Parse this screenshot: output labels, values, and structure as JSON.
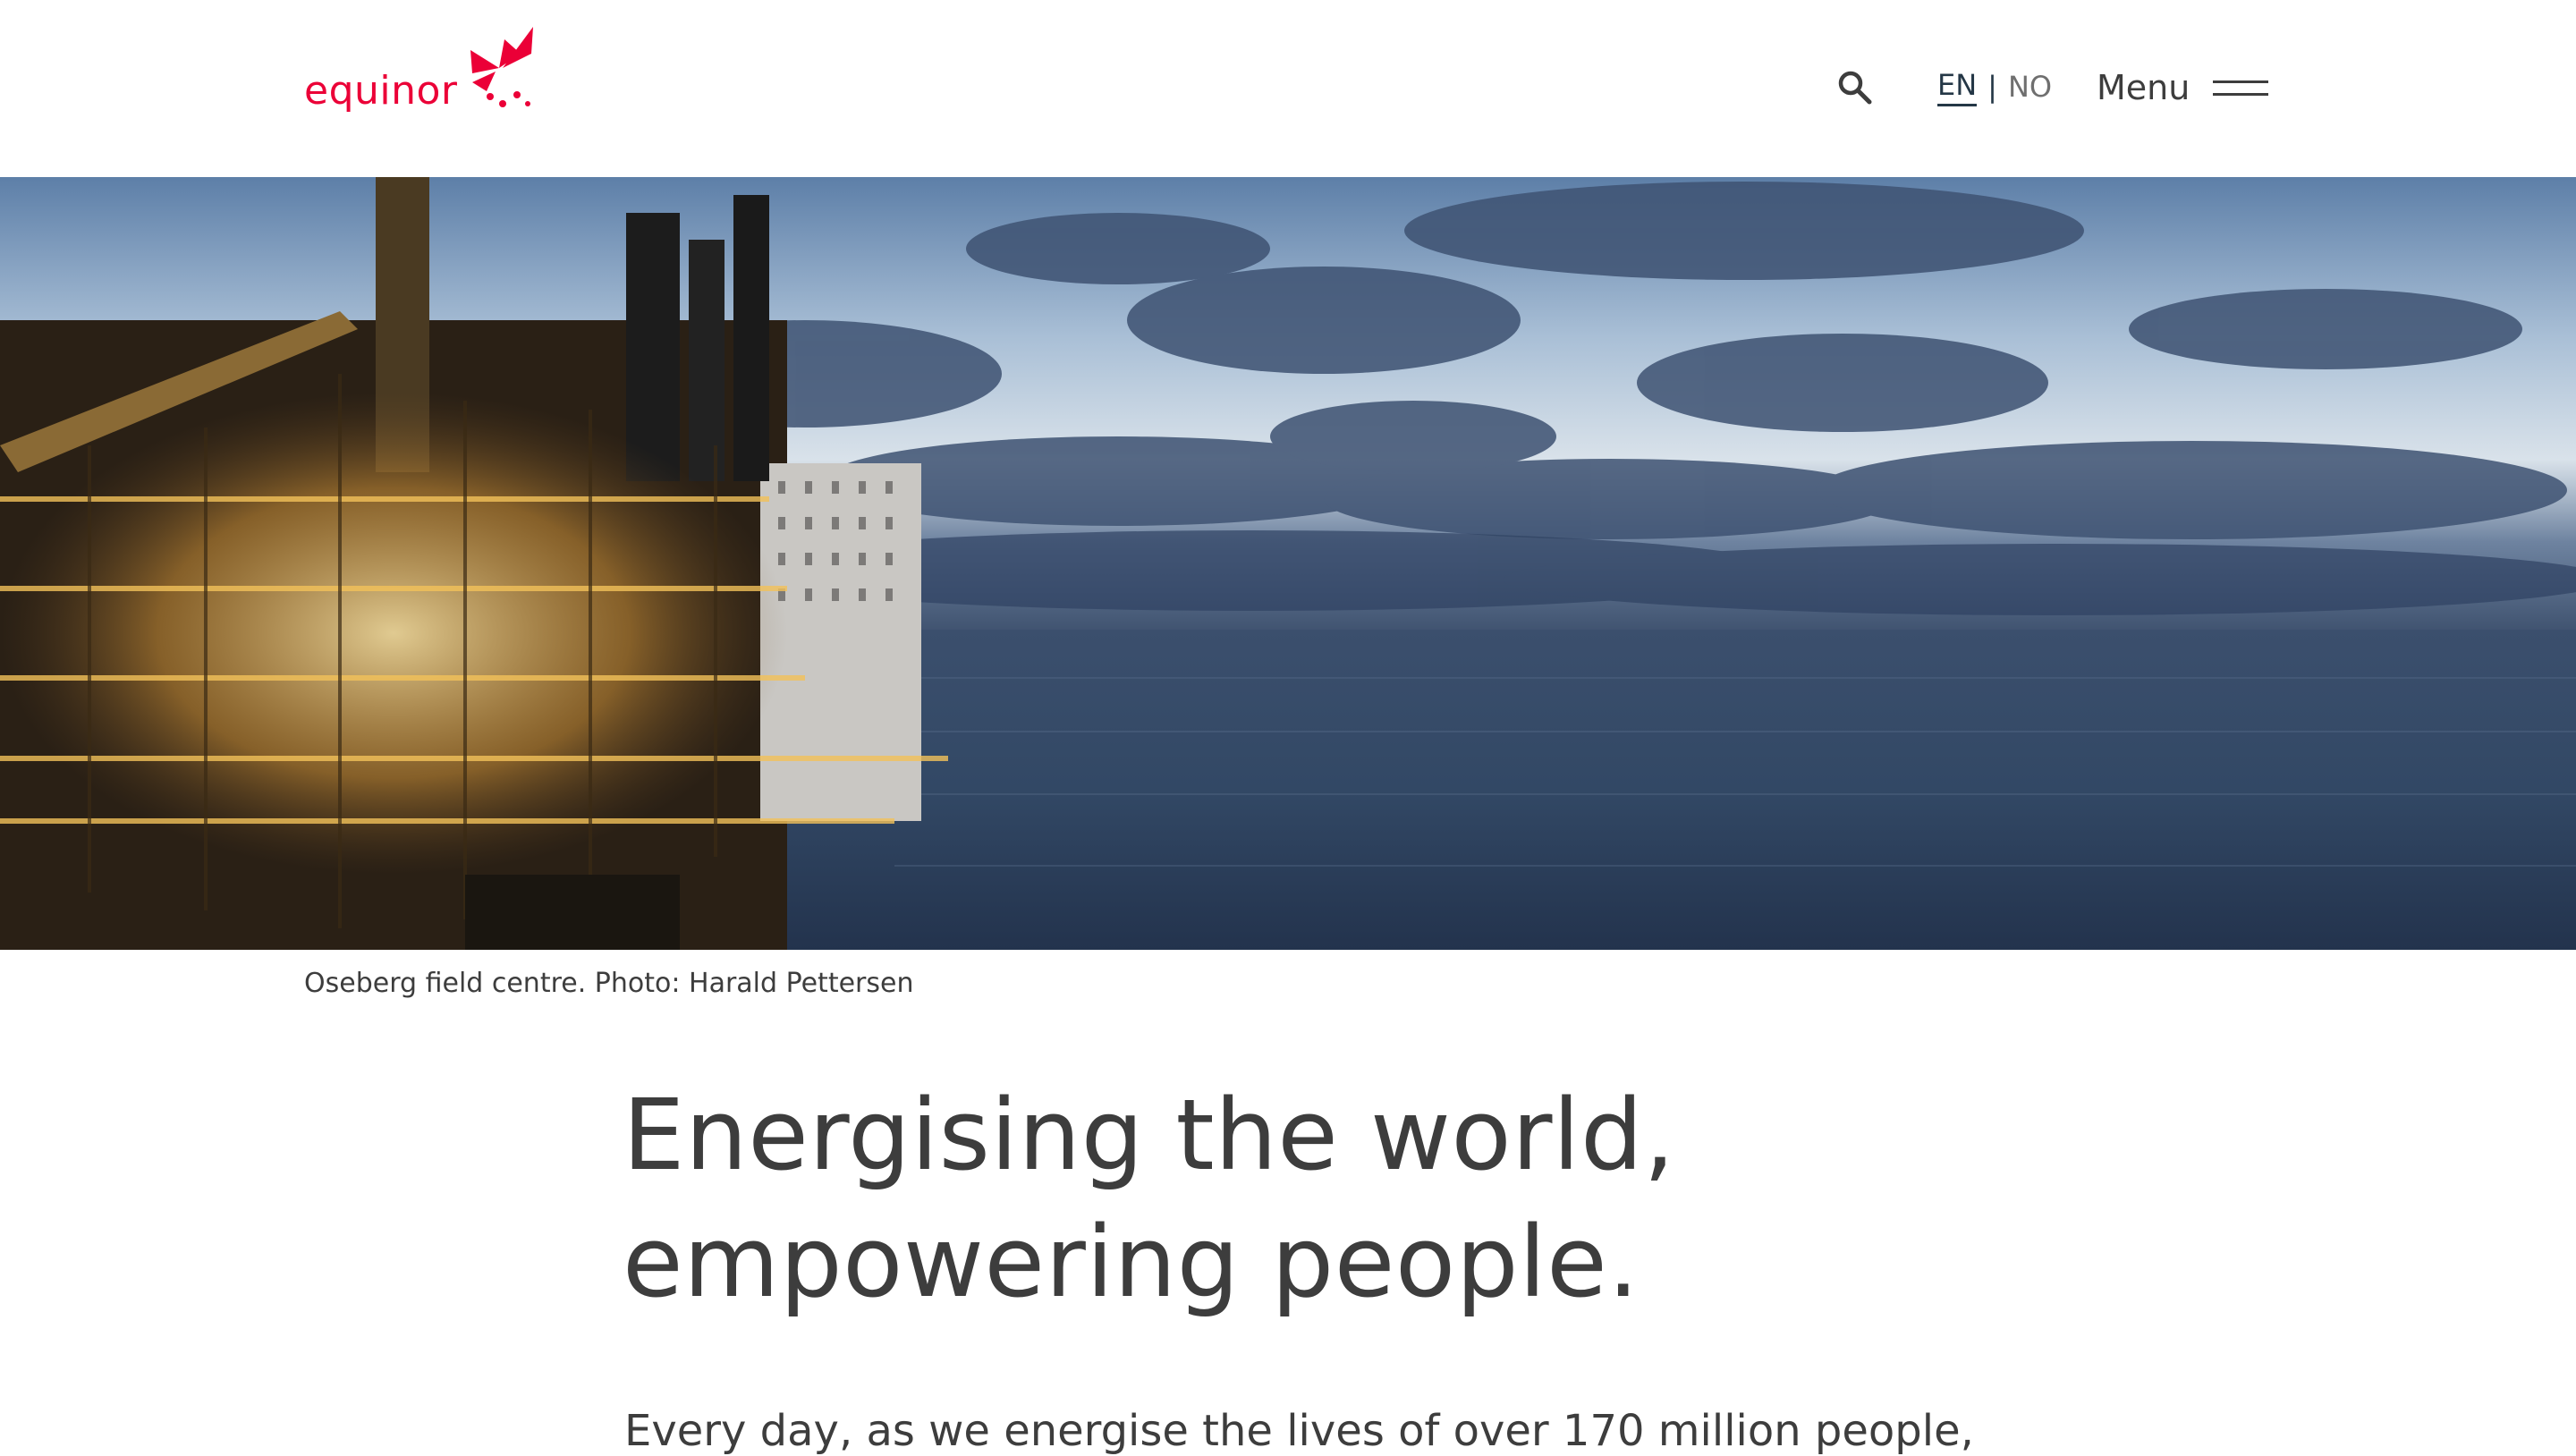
{
  "brand": {
    "name": "equinor",
    "color": "#eb0037"
  },
  "header": {
    "search_icon": "search-icon",
    "lang_en": "EN",
    "lang_sep": "|",
    "lang_no": "NO",
    "menu_label": "Menu",
    "menu_icon": "hamburger-icon"
  },
  "hero": {
    "caption": "Oseberg field centre. Photo: Harald Pettersen"
  },
  "main": {
    "headline_line1": "Energising the world,",
    "headline_line2": "empowering people.",
    "lead": "Every day, as we energise the lives of over 170 million people,"
  },
  "colors": {
    "text": "#3d3d3d",
    "nav_active": "#243746",
    "nav_inactive": "#6f6f6f",
    "top_tab": "#4a4c52"
  }
}
